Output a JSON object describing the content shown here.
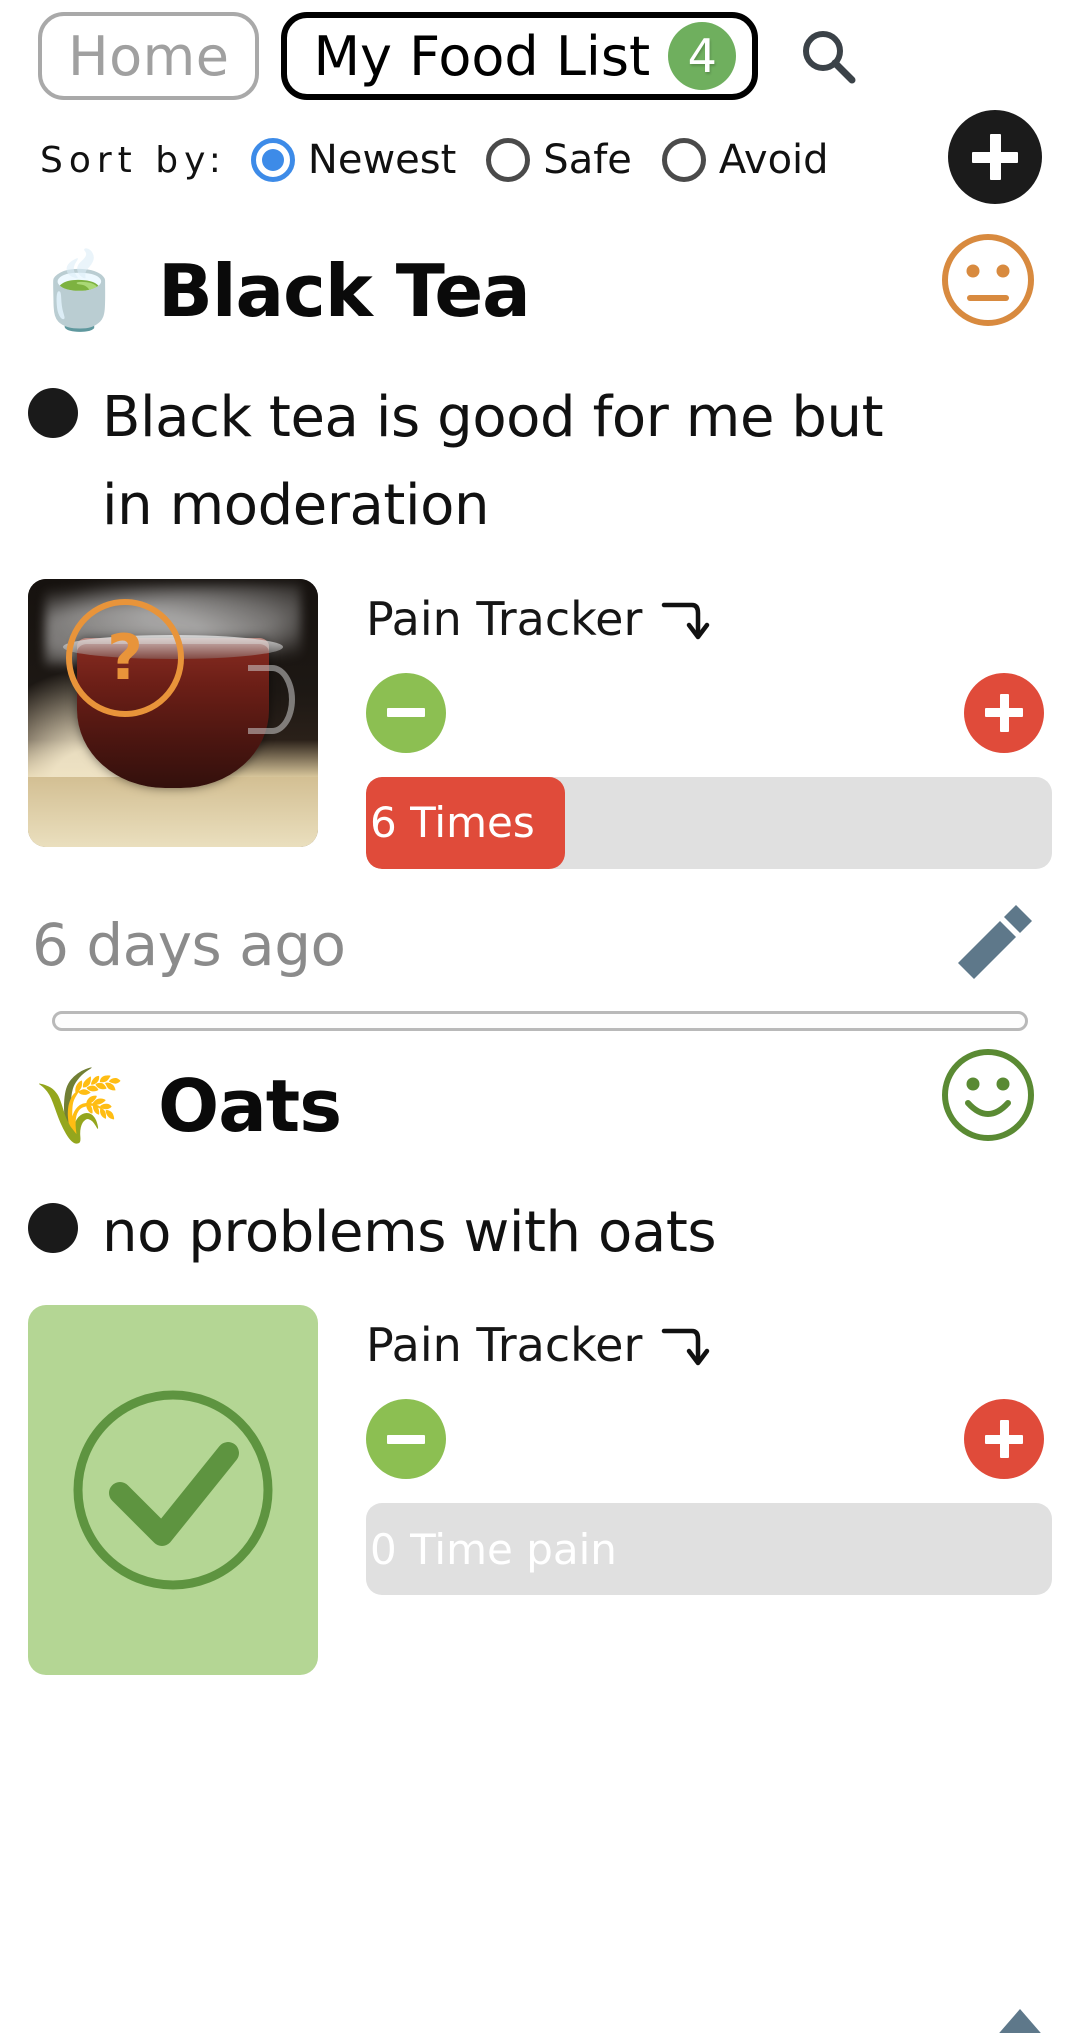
{
  "header": {
    "tab_home": "Home",
    "tab_active": "My Food List",
    "badge_count": "4",
    "search_icon": "search-icon"
  },
  "sort": {
    "label": "Sort by:",
    "options": [
      {
        "label": "Newest",
        "selected": true
      },
      {
        "label": "Safe",
        "selected": false
      },
      {
        "label": "Avoid",
        "selected": false
      }
    ],
    "add_button": "+"
  },
  "colors": {
    "accent_green": "#6FAF5E",
    "radio_blue": "#3D8BE8",
    "pain_red": "#E04B3A",
    "minus_green": "#8CBF52",
    "neutral_face_orange": "#D88A3F",
    "happy_face_green": "#5A8A33",
    "check_card_bg": "#B4D694",
    "track_gray": "#E0E0E0",
    "pencil_slate": "#5E788A",
    "question_orange": "#E8943A"
  },
  "foods": [
    {
      "emoji": "🍵",
      "emoji_name": "teacup-icon",
      "name": "Black Tea",
      "face": "neutral",
      "note": "Black tea is good for me  but in moderation",
      "thumb_kind": "photo",
      "thumb_badge": "?",
      "tracker": {
        "title": "Pain Tracker",
        "minus_label": "−",
        "plus_label": "+",
        "value_label": "6 Times",
        "fill_percent": 29,
        "fill_filled": true
      },
      "ago": "6 days ago",
      "edit_icon": "pencil-icon"
    },
    {
      "emoji": "🌾",
      "emoji_name": "wheat-icon",
      "name": "Oats",
      "face": "happy",
      "note": "no problems with oats",
      "thumb_kind": "check",
      "thumb_badge": "",
      "tracker": {
        "title": "Pain Tracker",
        "minus_label": "−",
        "plus_label": "+",
        "value_label": "0 Time pain",
        "fill_percent": 0,
        "fill_filled": false
      },
      "ago": "",
      "edit_icon": "pencil-icon"
    }
  ]
}
